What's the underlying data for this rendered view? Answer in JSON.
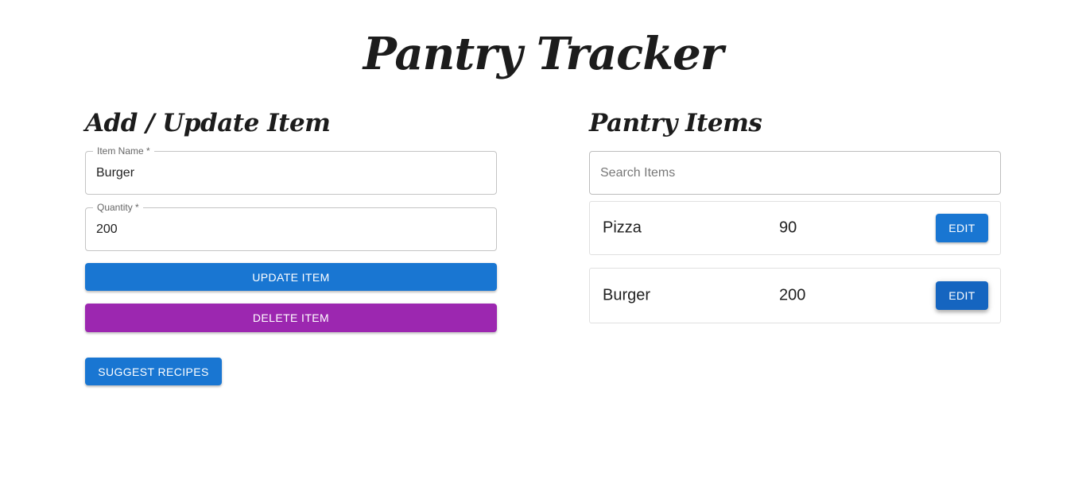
{
  "app": {
    "title": "Pantry Tracker"
  },
  "form": {
    "heading": "Add / Update Item",
    "item_name": {
      "label": "Item Name *",
      "value": "Burger"
    },
    "quantity": {
      "label": "Quantity *",
      "value": "200"
    },
    "update_label": "Update Item",
    "delete_label": "Delete Item",
    "suggest_label": "Suggest Recipes"
  },
  "pantry": {
    "heading": "Pantry Items",
    "search": {
      "placeholder": "Search Items",
      "value": ""
    },
    "items": [
      {
        "name": "Pizza",
        "quantity": "90",
        "edit_label": "Edit"
      },
      {
        "name": "Burger",
        "quantity": "200",
        "edit_label": "Edit"
      }
    ]
  },
  "colors": {
    "primary": "#1976d2",
    "secondary": "#9c27b0"
  }
}
